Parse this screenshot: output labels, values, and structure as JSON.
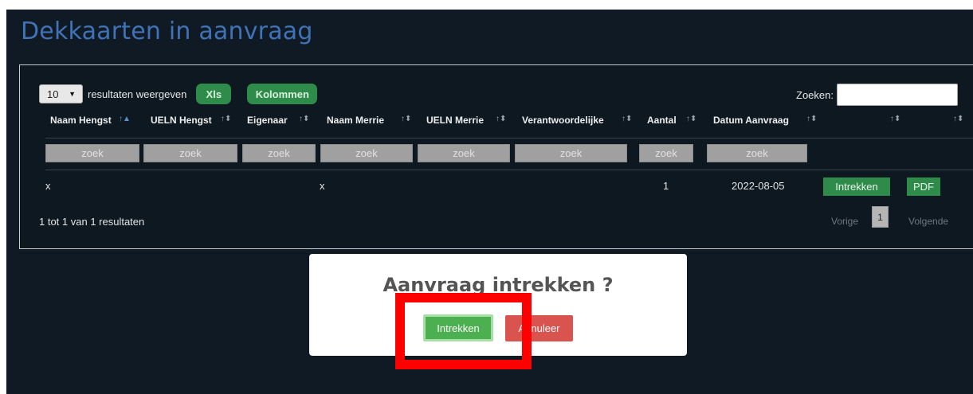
{
  "page": {
    "title": "Dekkaarten in aanvraag"
  },
  "toolbar": {
    "length_value": "10",
    "length_label": "resultaten weergeven",
    "xls_label": "Xls",
    "kolommen_label": "Kolommen",
    "search_label": "Zoeken:",
    "search_value": ""
  },
  "table": {
    "columns": [
      "Naam Hengst",
      "UELN Hengst",
      "Eigenaar",
      "Naam Merrie",
      "UELN Merrie",
      "Verantwoordelijke",
      "Aantal",
      "Datum Aanvraag",
      "",
      ""
    ],
    "filter_placeholder": "zoek",
    "rows": [
      {
        "naam_hengst": "x",
        "ueln_hengst": "",
        "eigenaar": "",
        "naam_merrie": "x",
        "ueln_merrie": "",
        "verantwoordelijke": "",
        "aantal": "1",
        "datum_aanvraag": "2022-08-05",
        "action_1": "Intrekken",
        "action_2": "PDF"
      }
    ]
  },
  "footer": {
    "info": "1 tot 1 van 1 resultaten",
    "prev_label": "Vorige",
    "current_page": "1",
    "next_label": "Volgende"
  },
  "modal": {
    "title": "Aanvraag intrekken ?",
    "confirm_label": "Intrekken",
    "cancel_label": "Annuleer"
  },
  "colors": {
    "background": "#101a24",
    "title": "#3f72b6",
    "accent_green": "#2e8b4a",
    "confirm_green": "#4caf50",
    "cancel_red": "#d9534f",
    "highlight_red": "#ff0000"
  }
}
